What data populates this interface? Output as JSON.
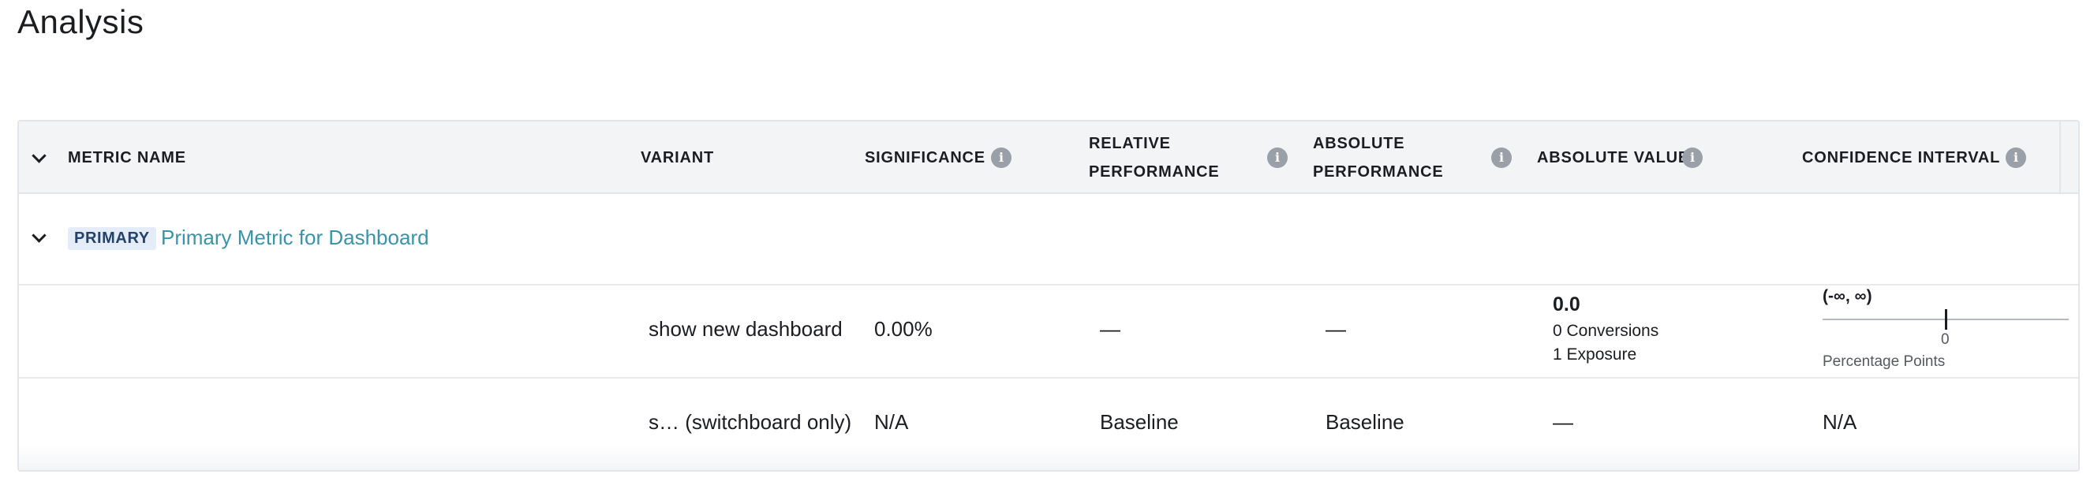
{
  "page": {
    "title": "Analysis"
  },
  "table": {
    "headers": {
      "metric_name": "METRIC NAME",
      "variant": "VARIANT",
      "significance": "SIGNIFICANCE",
      "relative_performance_l1": "RELATIVE",
      "relative_performance_l2": "PERFORMANCE",
      "absolute_performance_l1": "ABSOLUTE",
      "absolute_performance_l2": "PERFORMANCE",
      "absolute_value": "ABSOLUTE VALUE",
      "confidence_interval": "CONFIDENCE INTERVAL"
    },
    "metric_group": {
      "badge": "PRIMARY",
      "name": "Primary Metric for Dashboard"
    },
    "rows": [
      {
        "variant": "show new dashboard",
        "significance": "0.00%",
        "relative_performance": "—",
        "absolute_performance": "—",
        "absolute_value": "0.0",
        "conversions": "0 Conversions",
        "exposures": "1 Exposure",
        "ci_range": "(-∞, ∞)",
        "ci_tick": "0",
        "ci_unit": "Percentage Points"
      },
      {
        "variant": "s…  (switchboard only)",
        "significance": "N/A",
        "relative_performance": "Baseline",
        "absolute_performance": "Baseline",
        "absolute_value": "—",
        "confidence_interval": "N/A"
      }
    ]
  },
  "icons": {
    "info": "info-icon",
    "expand_all": "chevron-down-icon",
    "expand_group": "chevron-down-icon"
  },
  "colors": {
    "link": "#3b93a8",
    "badge_bg": "#e3ecf7",
    "badge_text": "#25426b",
    "header_bg": "#f3f4f6",
    "info_icon": "#9aa0a8"
  }
}
